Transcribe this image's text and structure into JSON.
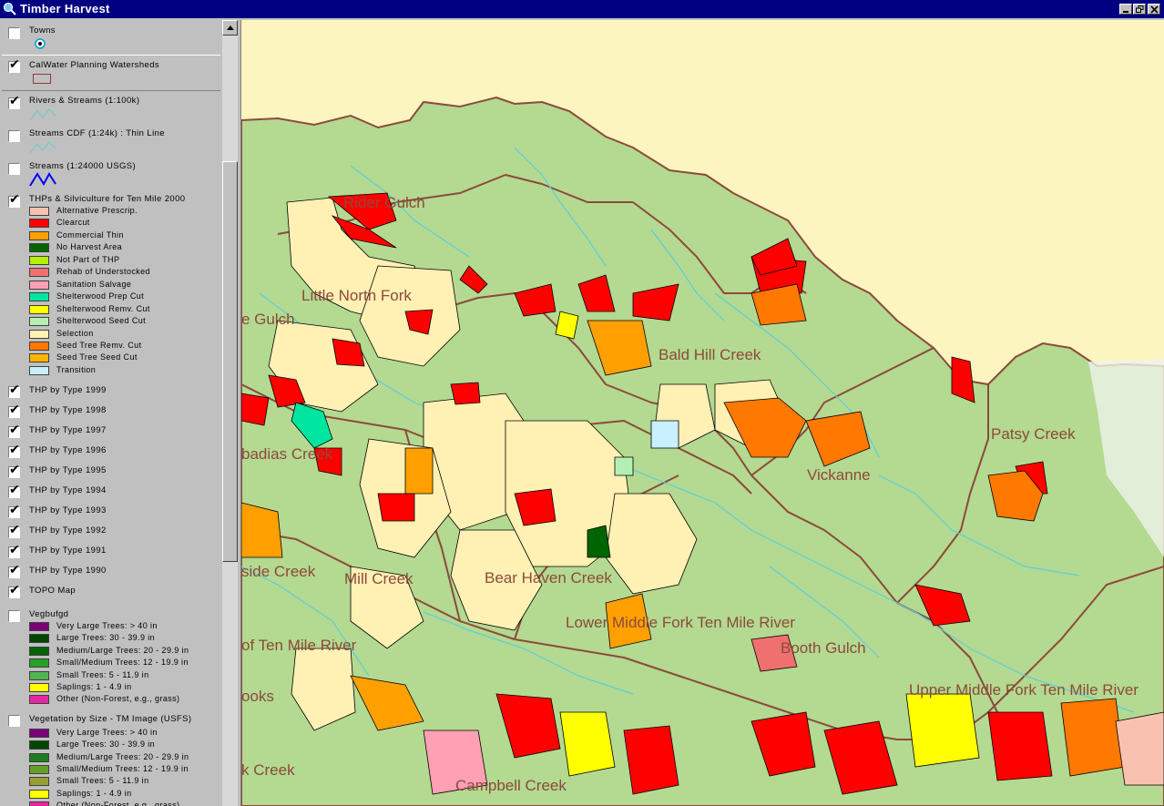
{
  "window": {
    "title": "Timber Harvest"
  },
  "legend": {
    "towns": {
      "label": "Towns",
      "checked": false
    },
    "calwater": {
      "label": "CalWater Planning Watersheds",
      "checked": true
    },
    "rivers": {
      "label": "Rivers & Streams (1:100k)",
      "checked": true
    },
    "streams_cdf": {
      "label": "Streams CDF (1:24k) : Thin Line",
      "checked": false
    },
    "streams_usgs": {
      "label": "Streams (1:24000 USGS)",
      "checked": false
    },
    "thps": {
      "label": "THPs & Silviculture for Ten Mile 2000",
      "checked": true,
      "classes": [
        {
          "label": "Alternative Prescrip.",
          "color": "#f9c2b0"
        },
        {
          "label": "Clearcut",
          "color": "#ff0000"
        },
        {
          "label": "Commercial Thin",
          "color": "#ffa000"
        },
        {
          "label": "No Harvest Area",
          "color": "#006400"
        },
        {
          "label": "Not Part of THP",
          "color": "#b4f000"
        },
        {
          "label": "Rehab of Understocked",
          "color": "#f07070"
        },
        {
          "label": "Sanitation Salvage",
          "color": "#ffa0b4"
        },
        {
          "label": "Shelterwood Prep Cut",
          "color": "#00e6a0"
        },
        {
          "label": "Shelterwood Remv. Cut",
          "color": "#ffff00"
        },
        {
          "label": "Shelterwood Seed Cut",
          "color": "#b4f0b4"
        },
        {
          "label": "Selection",
          "color": "#fff0b4"
        },
        {
          "label": "Seed Tree Remv. Cut",
          "color": "#ff7800"
        },
        {
          "label": "Seed Tree Seed Cut",
          "color": "#ffb400"
        },
        {
          "label": "Transition",
          "color": "#c8f0ff"
        }
      ]
    },
    "thp_years": [
      {
        "label": "THP by Type 1999",
        "checked": true
      },
      {
        "label": "THP by Type 1998",
        "checked": true
      },
      {
        "label": "THP by Type 1997",
        "checked": true
      },
      {
        "label": "THP by Type 1996",
        "checked": true
      },
      {
        "label": "THP by Type 1995",
        "checked": true
      },
      {
        "label": "THP by Type 1994",
        "checked": true
      },
      {
        "label": "THP by Type 1993",
        "checked": true
      },
      {
        "label": "THP by Type 1992",
        "checked": true
      },
      {
        "label": "THP by Type 1991",
        "checked": true
      },
      {
        "label": "THP by Type 1990",
        "checked": true
      }
    ],
    "topo": {
      "label": "TOPO Map",
      "checked": true
    },
    "vegbufgd": {
      "label": "Vegbufgd",
      "checked": false,
      "classes": [
        {
          "label": "Very Large Trees: > 40  in",
          "color": "#780078"
        },
        {
          "label": "Large Trees: 30 - 39.9 in",
          "color": "#004600"
        },
        {
          "label": "Medium/Large Trees: 20 - 29.9 in",
          "color": "#006400"
        },
        {
          "label": "Small/Medium Trees: 12 - 19.9 in",
          "color": "#28a028"
        },
        {
          "label": "Small Trees: 5 - 11.9 in",
          "color": "#50b450"
        },
        {
          "label": "Saplings: 1 - 4.9 in",
          "color": "#ffff00"
        },
        {
          "label": "Other (Non-Forest, e.g., grass)",
          "color": "#e628a0"
        }
      ]
    },
    "vegsize": {
      "label": "Vegetation by Size - TM Image (USFS)",
      "checked": false,
      "classes": [
        {
          "label": "Very Large Trees: > 40  in",
          "color": "#780078"
        },
        {
          "label": "Large Trees: 30 - 39.9 in",
          "color": "#004600"
        },
        {
          "label": "Medium/Large Trees: 20 - 29.9 in",
          "color": "#1e7d1e"
        },
        {
          "label": "Small/Medium Trees: 12 - 19.9 in",
          "color": "#64a028"
        },
        {
          "label": "Small Trees: 5 - 11.9 in",
          "color": "#96a032"
        },
        {
          "label": "Saplings: 1 - 4.9 in",
          "color": "#ffff00"
        },
        {
          "label": "Other (Non-Forest, e.g., grass)",
          "color": "#e628a0"
        }
      ]
    }
  },
  "map": {
    "labels": {
      "rider_gulch": "Rider Gulch",
      "little_north_fork": "Little North Fork",
      "e_gulch": "e Gulch",
      "bald_hill_creek": "Bald Hill Creek",
      "patsy_creek": "Patsy Creek",
      "vickanne": "Vickanne",
      "abadias_creek": "badias Creek",
      "side_creek": "side Creek",
      "mill_creek": "Mill Creek",
      "bear_haven_creek": "Bear Haven Creek",
      "lower_middle_fork": "Lower Middle Fork Ten Mile River",
      "booth_gulch": "Booth Gulch",
      "of_ten_mile_river": "of Ten Mile River",
      "upper_middle_fork": "Upper Middle Fork Ten Mile River",
      "k_creek": "k Creek",
      "ooks": "ooks",
      "campbell_creek": "Campbell Creek"
    }
  }
}
